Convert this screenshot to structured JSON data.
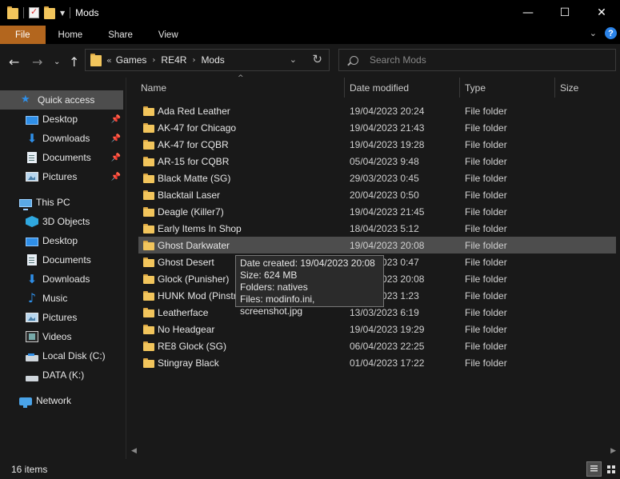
{
  "window": {
    "title": "Mods"
  },
  "ribbon": {
    "tabs": [
      "File",
      "Home",
      "Share",
      "View"
    ]
  },
  "address": {
    "overflow": "«",
    "crumbs": [
      "Games",
      "RE4R",
      "Mods"
    ]
  },
  "search": {
    "placeholder": "Search Mods"
  },
  "sidebar": {
    "quick_access": "Quick access",
    "quick_items": [
      "Desktop",
      "Downloads",
      "Documents",
      "Pictures"
    ],
    "this_pc": "This PC",
    "pc_items": [
      "3D Objects",
      "Desktop",
      "Documents",
      "Downloads",
      "Music",
      "Pictures",
      "Videos",
      "Local Disk (C:)",
      "DATA (K:)"
    ],
    "network": "Network"
  },
  "columns": {
    "name": "Name",
    "date": "Date modified",
    "type": "Type",
    "size": "Size"
  },
  "files": [
    {
      "name": "Ada Red Leather",
      "date": "19/04/2023 20:24",
      "type": "File folder"
    },
    {
      "name": "AK-47 for Chicago",
      "date": "19/04/2023 21:43",
      "type": "File folder"
    },
    {
      "name": "AK-47 for CQBR",
      "date": "19/04/2023 19:28",
      "type": "File folder"
    },
    {
      "name": "AR-15 for CQBR",
      "date": "05/04/2023 9:48",
      "type": "File folder"
    },
    {
      "name": "Black Matte (SG)",
      "date": "29/03/2023 0:45",
      "type": "File folder"
    },
    {
      "name": "Blacktail Laser",
      "date": "20/04/2023 0:50",
      "type": "File folder"
    },
    {
      "name": "Deagle (Killer7)",
      "date": "19/04/2023 21:45",
      "type": "File folder"
    },
    {
      "name": "Early Items In Shop",
      "date": "18/04/2023 5:12",
      "type": "File folder"
    },
    {
      "name": "Ghost Darkwater",
      "date": "19/04/2023 20:08",
      "type": "File folder"
    },
    {
      "name": "Ghost Desert",
      "date": "19/04/2023 0:47",
      "type": "File folder"
    },
    {
      "name": "Glock (Punisher)",
      "date": "19/04/2023 20:08",
      "type": "File folder"
    },
    {
      "name": "HUNK Mod (Pinstripe)",
      "date": "19/04/2023 1:23",
      "type": "File folder"
    },
    {
      "name": "Leatherface",
      "date": "13/03/2023 6:19",
      "type": "File folder"
    },
    {
      "name": "No Headgear",
      "date": "19/04/2023 19:29",
      "type": "File folder"
    },
    {
      "name": "RE8 Glock (SG)",
      "date": "06/04/2023 22:25",
      "type": "File folder"
    },
    {
      "name": "Stingray Black",
      "date": "01/04/2023 17:22",
      "type": "File folder"
    }
  ],
  "tooltip": {
    "created": "Date created: 19/04/2023 20:08",
    "size": "Size: 624 MB",
    "folders": "Folders: natives",
    "files": "Files: modinfo.ini, screenshot.jpg"
  },
  "status": {
    "items": "16 items"
  },
  "colors": {
    "file_tab": "#b3661e",
    "folder": "#f2c55c",
    "accent": "#2f8fe8",
    "selection": "#4d4d4d"
  }
}
